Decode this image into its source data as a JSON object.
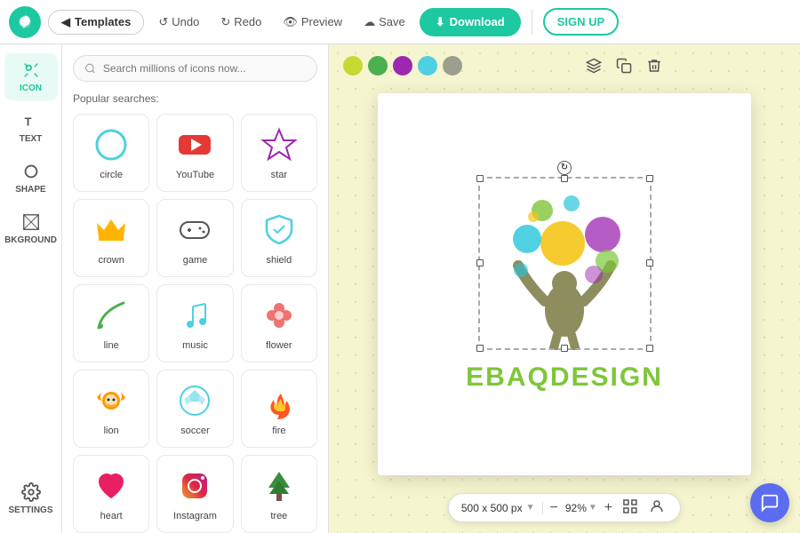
{
  "topbar": {
    "templates_label": "Templates",
    "undo_label": "Undo",
    "redo_label": "Redo",
    "preview_label": "Preview",
    "save_label": "Save",
    "download_label": "Download",
    "signup_label": "SIGN UP"
  },
  "sidebar": {
    "items": [
      {
        "id": "icon",
        "label": "ICON",
        "active": true
      },
      {
        "id": "text",
        "label": "TEXT",
        "active": false
      },
      {
        "id": "shape",
        "label": "SHAPE",
        "active": false
      },
      {
        "id": "background",
        "label": "BKGROUND",
        "active": false
      },
      {
        "id": "settings",
        "label": "SETTINGS",
        "active": false
      }
    ]
  },
  "icon_panel": {
    "search_placeholder": "Search millions of icons now...",
    "popular_label": "Popular searches:",
    "icons": [
      {
        "name": "circle",
        "color": "#4dd0e1"
      },
      {
        "name": "YouTube",
        "color": "#e53935"
      },
      {
        "name": "star",
        "color": "#9c27b0"
      },
      {
        "name": "crown",
        "color": "#ffb300"
      },
      {
        "name": "game",
        "color": "#555"
      },
      {
        "name": "shield",
        "color": "#4dd0e1"
      },
      {
        "name": "line",
        "color": "#4caf50"
      },
      {
        "name": "music",
        "color": "#4dd0e1"
      },
      {
        "name": "flower",
        "color": "#e53935"
      },
      {
        "name": "lion",
        "color": "#ff9800"
      },
      {
        "name": "soccer",
        "color": "#4dd0e1"
      },
      {
        "name": "fire",
        "color": "#ff5722"
      },
      {
        "name": "heart",
        "color": "#e91e63"
      },
      {
        "name": "Instagram",
        "color": "#c2185b"
      },
      {
        "name": "tree",
        "color": "#388e3c"
      }
    ]
  },
  "canvas": {
    "brand_name": "EBAQDESIGN",
    "size_label": "500 x 500 px",
    "zoom_label": "92%"
  },
  "colors": [
    {
      "hex": "#c6d933",
      "selected": false
    },
    {
      "hex": "#4caf50",
      "selected": false
    },
    {
      "hex": "#9c27b0",
      "selected": false
    },
    {
      "hex": "#4dd0e1",
      "selected": false
    },
    {
      "hex": "#9e9e8e",
      "selected": false
    }
  ]
}
